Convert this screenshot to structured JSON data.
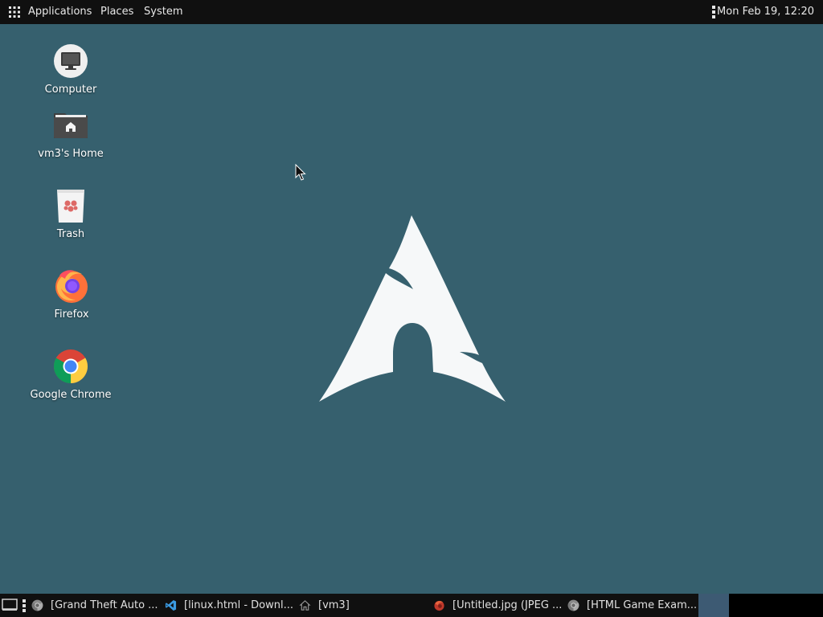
{
  "top_panel": {
    "menus": [
      "Applications",
      "Places",
      "System"
    ],
    "clock": "Mon Feb 19, 12:20",
    "apps_icon": "app-grid-icon",
    "menu_icon": "kebab-menu-icon"
  },
  "desktop_icons": [
    {
      "label": "Computer",
      "icon": "computer-icon"
    },
    {
      "label": "vm3's Home",
      "icon": "home-folder-icon"
    },
    {
      "label": "Trash",
      "icon": "trash-icon"
    },
    {
      "label": "Firefox",
      "icon": "firefox-icon"
    },
    {
      "label": "Google Chrome",
      "icon": "chrome-icon"
    }
  ],
  "wallpaper": {
    "logo": "arch-linux-logo",
    "background_color": "#36606e",
    "logo_color": "#f6f8f9"
  },
  "taskbar": {
    "show_desktop_icon": "show-desktop-icon",
    "tasks": [
      {
        "label": "[Grand Theft Auto ...",
        "icon": "chrome-icon"
      },
      {
        "label": "[linux.html - Downl...",
        "icon": "vscode-icon"
      },
      {
        "label": "[vm3]",
        "icon": "home-folder-icon"
      },
      {
        "label": "[Untitled.jpg (JPEG ...",
        "icon": "image-viewer-icon"
      },
      {
        "label": "[HTML Game Exam...",
        "icon": "chrome-icon"
      }
    ],
    "workspaces": {
      "active_color": "#3d5a73"
    }
  }
}
